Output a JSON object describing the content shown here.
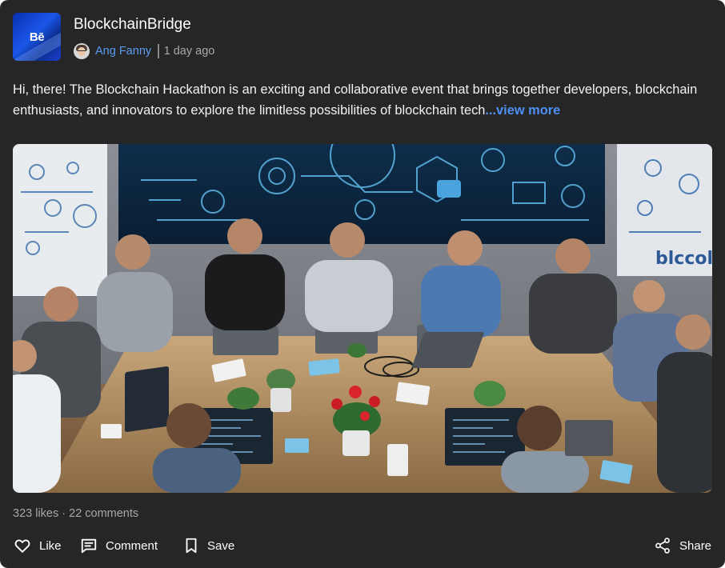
{
  "post": {
    "group_name": "BlockchainBridge",
    "group_logo_text": "Bē",
    "author": "Ang Fanny",
    "time": "1 day ago",
    "text": "Hi, there! The Blockchain Hackathon is an exciting and collaborative event that brings together developers, blockchain enthusiasts, and innovators to explore the limitless possibilities of blockchain tech",
    "view_more": "...view more",
    "image_alt": "Group of developers working on laptops around a table at a blockchain hackathon",
    "image_sign_text": "blccoln",
    "stats": "323 likes · 22 comments"
  },
  "actions": {
    "like": "Like",
    "comment": "Comment",
    "save": "Save",
    "share": "Share"
  },
  "icons": {
    "like": "heart-icon",
    "comment": "comment-icon",
    "save": "bookmark-icon",
    "share": "share-icon"
  },
  "colors": {
    "card_bg": "#262626",
    "link_blue": "#5b9cf2",
    "view_more_blue": "#4d8ff5",
    "muted_text": "#a8a8a8"
  }
}
